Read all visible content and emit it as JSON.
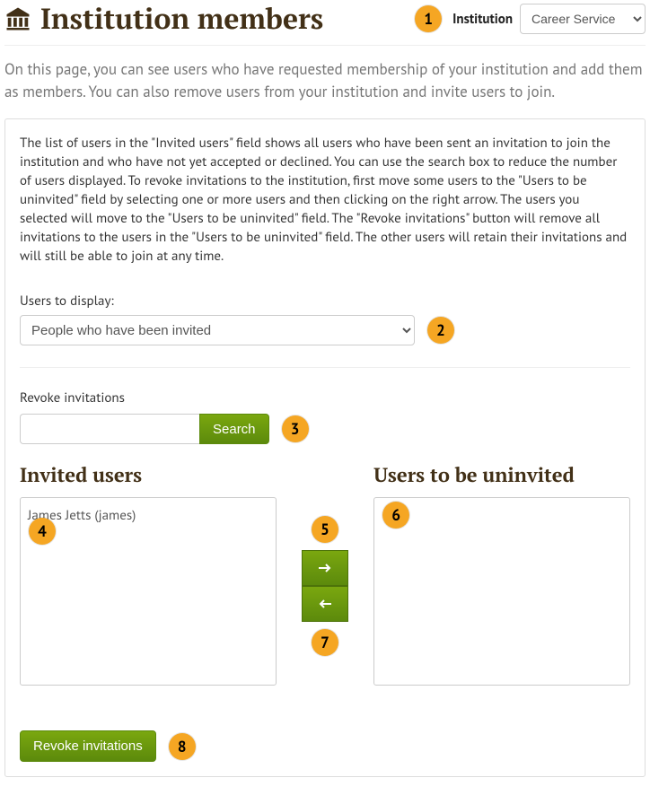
{
  "header": {
    "title": "Institution members",
    "institution_label": "Institution",
    "institution_selected": "Career Service"
  },
  "intro": "On this page, you can see users who have requested membership of your institution and add them as members. You can also remove users from your institution and invite users to join.",
  "help_text": "The list of users in the \"Invited users\" field shows all users who have been sent an invitation to join the institution and who have not yet accepted or declined. You can use the search box to reduce the number of users displayed. To revoke invitations to the institution, first move some users to the \"Users to be uninvited\" field by selecting one or more users and then clicking on the right arrow. The users you selected will move to the \"Users to be uninvited\" field. The \"Revoke invitations\" button will remove all invitations to the users in the \"Users to be uninvited\" field. The other users will retain their invitations and will still be able to join at any time.",
  "users_to_display": {
    "label": "Users to display:",
    "selected": "People who have been invited"
  },
  "revoke_section": {
    "heading": "Revoke invitations",
    "search_button": "Search",
    "search_value": ""
  },
  "lists": {
    "left_heading": "Invited users",
    "right_heading": "Users to be uninvited",
    "invited": [
      "James Jetts (james)"
    ],
    "to_uninvite": []
  },
  "actions": {
    "revoke_button": "Revoke invitations"
  },
  "annotations": {
    "a1": "1",
    "a2": "2",
    "a3": "3",
    "a4": "4",
    "a5": "5",
    "a6": "6",
    "a7": "7",
    "a8": "8"
  }
}
